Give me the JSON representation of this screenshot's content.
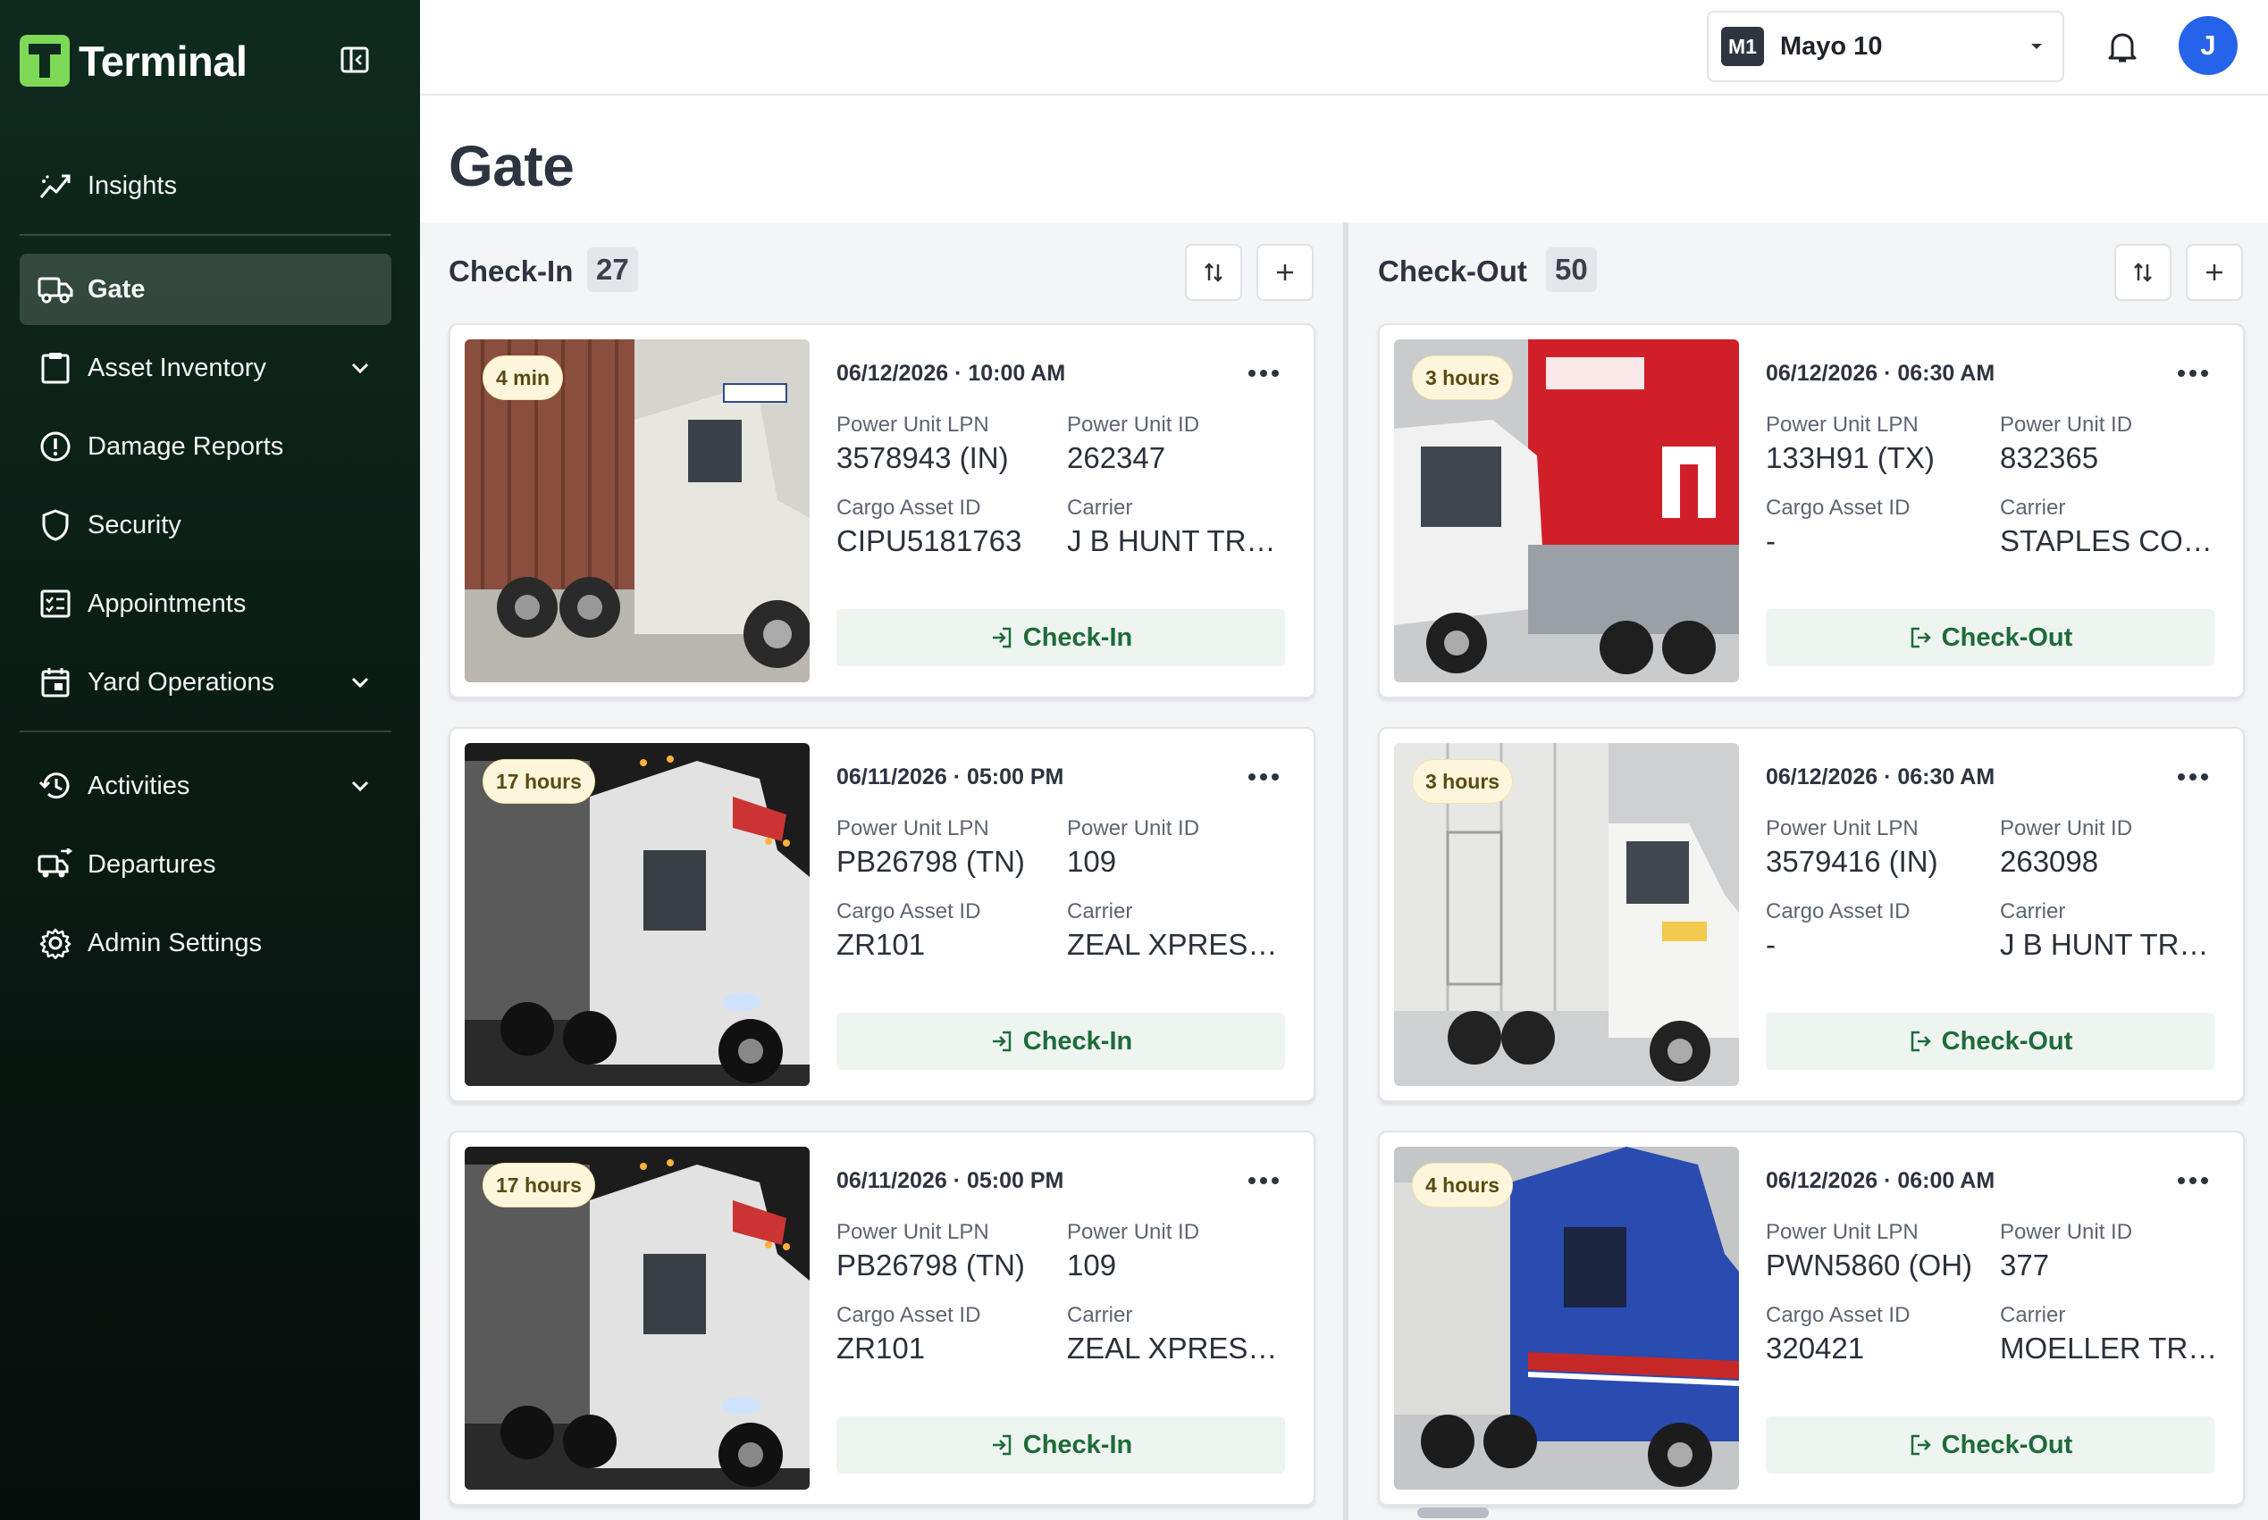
{
  "app": {
    "name": "Terminal"
  },
  "sidebar": {
    "items": [
      {
        "label": "Insights",
        "icon": "insights-icon"
      },
      {
        "label": "Gate",
        "icon": "truck-icon",
        "active": true
      },
      {
        "label": "Asset Inventory",
        "icon": "clipboard-icon",
        "expandable": true
      },
      {
        "label": "Damage Reports",
        "icon": "alert-circle-icon"
      },
      {
        "label": "Security",
        "icon": "shield-icon"
      },
      {
        "label": "Appointments",
        "icon": "checklist-icon"
      },
      {
        "label": "Yard Operations",
        "icon": "calendar-icon",
        "expandable": true
      },
      {
        "label": "Activities",
        "icon": "history-icon",
        "expandable": true
      },
      {
        "label": "Departures",
        "icon": "departures-icon"
      },
      {
        "label": "Admin Settings",
        "icon": "gear-icon"
      }
    ]
  },
  "topbar": {
    "location": {
      "badge": "M1",
      "name": "Mayo 10"
    },
    "avatar_initial": "J"
  },
  "page": {
    "title": "Gate"
  },
  "columns": {
    "checkin": {
      "title": "Check-In",
      "count": "27",
      "cards": [
        {
          "age": "4 min",
          "datetime": "06/12/2026 · 10:00 AM",
          "lpn_label": "Power Unit LPN",
          "lpn": "3578943 (IN)",
          "unit_label": "Power Unit ID",
          "unit": "262347",
          "cargo_label": "Cargo Asset ID",
          "cargo": "CIPU5181763",
          "carrier_label": "Carrier",
          "carrier": "J B HUNT TRANSPORT",
          "action": "Check-In"
        },
        {
          "age": "17 hours",
          "datetime": "06/11/2026 · 05:00 PM",
          "lpn_label": "Power Unit LPN",
          "lpn": "PB26798 (TN)",
          "unit_label": "Power Unit ID",
          "unit": "109",
          "cargo_label": "Cargo Asset ID",
          "cargo": "ZR101",
          "carrier_label": "Carrier",
          "carrier": "ZEAL XPRESS LLC",
          "action": "Check-In"
        },
        {
          "age": "17 hours",
          "datetime": "06/11/2026 · 05:00 PM",
          "lpn_label": "Power Unit LPN",
          "lpn": "PB26798 (TN)",
          "unit_label": "Power Unit ID",
          "unit": "109",
          "cargo_label": "Cargo Asset ID",
          "cargo": "ZR101",
          "carrier_label": "Carrier",
          "carrier": "ZEAL XPRESS LLC",
          "action": "Check-In"
        }
      ]
    },
    "checkout": {
      "title": "Check-Out",
      "count": "50",
      "cards": [
        {
          "age": "3 hours",
          "datetime": "06/12/2026 · 06:30 AM",
          "lpn_label": "Power Unit LPN",
          "lpn": "133H91 (TX)",
          "unit_label": "Power Unit ID",
          "unit": "832365",
          "cargo_label": "Cargo Asset ID",
          "cargo": "-",
          "carrier_label": "Carrier",
          "carrier": "STAPLES CONTRACT",
          "action": "Check-Out"
        },
        {
          "age": "3 hours",
          "datetime": "06/12/2026 · 06:30 AM",
          "lpn_label": "Power Unit LPN",
          "lpn": "3579416 (IN)",
          "unit_label": "Power Unit ID",
          "unit": "263098",
          "cargo_label": "Cargo Asset ID",
          "cargo": "-",
          "carrier_label": "Carrier",
          "carrier": "J B HUNT TRANSPORT",
          "action": "Check-Out"
        },
        {
          "age": "4 hours",
          "datetime": "06/12/2026 · 06:00 AM",
          "lpn_label": "Power Unit LPN",
          "lpn": "PWN5860 (OH)",
          "unit_label": "Power Unit ID",
          "unit": "377",
          "cargo_label": "Cargo Asset ID",
          "cargo": "320421",
          "carrier_label": "Carrier",
          "carrier": "MOELLER TRUCKING",
          "action": "Check-Out"
        }
      ]
    }
  },
  "colors": {
    "brand_green": "#7ed957",
    "sidebar_bg": "#0e2a1e",
    "action_text": "#1d6b3a",
    "action_bg": "#eef4ef",
    "avatar": "#2563eb"
  }
}
